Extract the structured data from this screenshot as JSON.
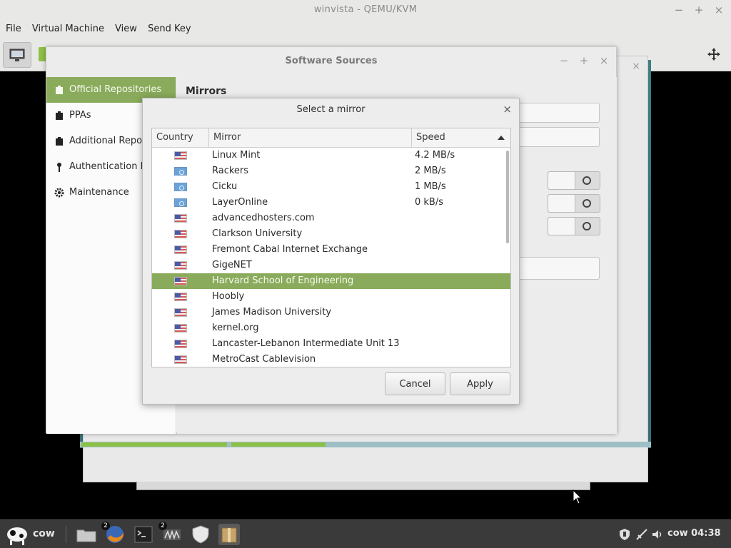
{
  "host_window": {
    "title": "winvista - QEMU/KVM",
    "menus": [
      "File",
      "Virtual Machine",
      "View",
      "Send Key"
    ]
  },
  "software_sources": {
    "title": "Software Sources",
    "sidebar": [
      {
        "label": "Official Repositories",
        "icon": "package-icon",
        "active": true
      },
      {
        "label": "PPAs",
        "icon": "package-icon",
        "active": false
      },
      {
        "label": "Additional Repositories",
        "icon": "package-icon",
        "active": false
      },
      {
        "label": "Authentication Keys",
        "icon": "key-icon",
        "active": false
      },
      {
        "label": "Maintenance",
        "icon": "gear-icon",
        "active": false
      }
    ],
    "main_heading": "Mirrors"
  },
  "mirror_dialog": {
    "title": "Select a mirror",
    "columns": {
      "country": "Country",
      "mirror": "Mirror",
      "speed": "Speed"
    },
    "sort": "speed-ascending",
    "rows": [
      {
        "flag": "us",
        "mirror": "Linux Mint",
        "speed": "4.2 MB/s"
      },
      {
        "flag": "un",
        "mirror": "Rackers",
        "speed": "2 MB/s"
      },
      {
        "flag": "un",
        "mirror": "Cicku",
        "speed": "1 MB/s"
      },
      {
        "flag": "un",
        "mirror": "LayerOnline",
        "speed": "0 kB/s"
      },
      {
        "flag": "us",
        "mirror": "advancedhosters.com",
        "speed": ""
      },
      {
        "flag": "us",
        "mirror": "Clarkson University",
        "speed": ""
      },
      {
        "flag": "us",
        "mirror": "Fremont Cabal Internet Exchange",
        "speed": ""
      },
      {
        "flag": "us",
        "mirror": "GigeNET",
        "speed": ""
      },
      {
        "flag": "us",
        "mirror": "Harvard School of Engineering",
        "speed": "",
        "selected": true
      },
      {
        "flag": "us",
        "mirror": "Hoobly",
        "speed": ""
      },
      {
        "flag": "us",
        "mirror": "James Madison University",
        "speed": ""
      },
      {
        "flag": "us",
        "mirror": "kernel.org",
        "speed": ""
      },
      {
        "flag": "us",
        "mirror": "Lancaster-Lebanon Intermediate Unit 13",
        "speed": ""
      },
      {
        "flag": "us",
        "mirror": "MetroCast Cablevision",
        "speed": ""
      }
    ],
    "buttons": {
      "cancel": "Cancel",
      "apply": "Apply"
    }
  },
  "taskbar": {
    "menu_label": "cow",
    "apps": [
      {
        "name": "files",
        "badge": ""
      },
      {
        "name": "firefox",
        "badge": "2"
      },
      {
        "name": "terminal",
        "badge": ""
      },
      {
        "name": "virt-manager",
        "badge": "2"
      },
      {
        "name": "update-manager",
        "badge": ""
      },
      {
        "name": "archive",
        "badge": ""
      }
    ],
    "tray_user_time": "cow 04:38"
  },
  "colors": {
    "accent": "#8aab5b",
    "panel": "#3a3a3a"
  }
}
